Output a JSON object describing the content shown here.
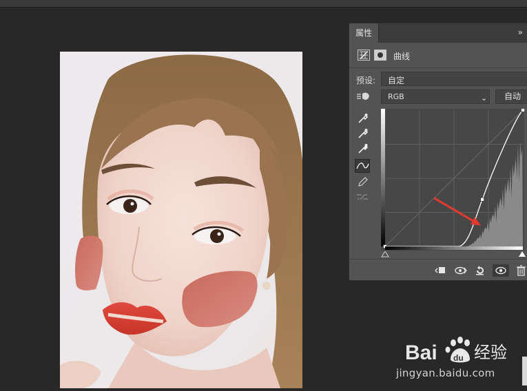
{
  "properties_panel": {
    "tab_label": "属性",
    "menu_glyph": "»",
    "adjustment_title": "曲线",
    "preset_label": "预设:",
    "preset_value": "自定",
    "channel_value": "RGB",
    "auto_button": "自动"
  },
  "curve": {
    "input_black": 0,
    "output_black": 0,
    "control_point_input": 180,
    "control_point_output": 88,
    "input_white": 255,
    "output_white": 255,
    "accent_color": "#e23a2f"
  },
  "icons": {
    "curves_grid": "curves-grid-icon",
    "layer_mask": "mask-icon",
    "target_adjust": "on-image-adjust-icon",
    "black_eyedropper": "eyedropper-black-icon",
    "gray_eyedropper": "eyedropper-gray-icon",
    "white_eyedropper": "eyedropper-white-icon",
    "point_curve": "curve-point-icon",
    "pencil": "pencil-icon",
    "smooth": "smooth-icon",
    "clip": "clip-to-layer-icon",
    "view_previous": "view-previous-icon",
    "reset": "reset-icon",
    "visibility": "eye-icon",
    "delete": "trash-icon"
  },
  "watermark": {
    "brand": "Bai",
    "brand_suffix": "经验",
    "domain": "jingyan.baidu.com"
  }
}
